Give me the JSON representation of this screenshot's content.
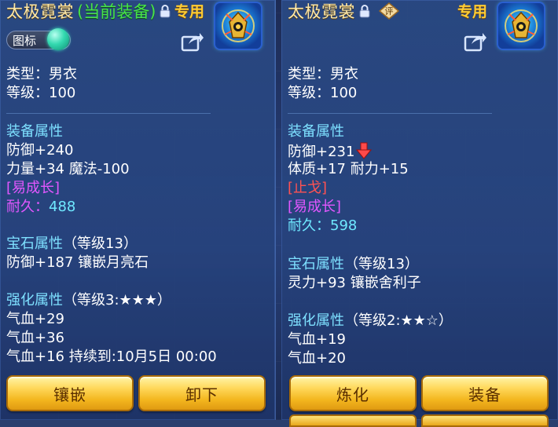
{
  "left": {
    "title": "太极霓裳",
    "title_tag": "(当前装备)",
    "exclusive": "专用",
    "toggle_label": "图标",
    "type_line": "类型：男衣",
    "level_line": "等级：100",
    "attr_header": "装备属性",
    "attr_lines": [
      "防御+240",
      "力量+34 魔法-100"
    ],
    "growth": "[易成长]",
    "durability_label": "耐久：",
    "durability_value": "488",
    "gem_header": "宝石属性",
    "gem_level": "（等级13）",
    "gem_line": "防御+187 镶嵌月亮石",
    "enhance_header": "强化属性",
    "enhance_level": "（等级3:★★★）",
    "enhance_lines": [
      "气血+29",
      "气血+36",
      "气血+16    持续到:10月5日 00:00"
    ],
    "buttons": [
      "镶嵌",
      "卸下"
    ]
  },
  "right": {
    "title": "太极霓裳",
    "exclusive": "专用",
    "eval_badge": "评",
    "type_line": "类型：男衣",
    "level_line": "等级：100",
    "attr_header": "装备属性",
    "attr_line_1": "防御+231",
    "attr_line_2": "体质+17 耐力+15",
    "special": "[止戈]",
    "growth": "[易成长]",
    "durability_label": "耐久：",
    "durability_value": "598",
    "gem_header": "宝石属性",
    "gem_level": "（等级13）",
    "gem_line": "灵力+93 镶嵌舍利子",
    "enhance_header": "强化属性",
    "enhance_level": "（等级2:★★☆）",
    "enhance_lines": [
      "气血+19",
      "气血+20"
    ],
    "buttons": [
      "炼化",
      "装备"
    ]
  },
  "icons": {
    "lock": "lock-icon",
    "share": "share-icon",
    "item": "armor-item-icon",
    "compare_down": "down-arrow-icon",
    "eval": "evaluate-icon"
  },
  "colors": {
    "title": "#ffe9a8",
    "equipped_tag": "#48e24c",
    "section": "#7ee0ff",
    "growth": "#e257ff",
    "special": "#ff5252",
    "durability": "#6fe8ff",
    "button": "#f3b61e"
  }
}
